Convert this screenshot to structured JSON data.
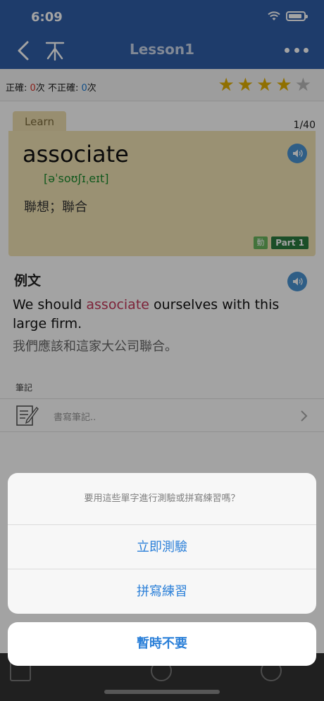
{
  "status_bar": {
    "time": "6:09"
  },
  "nav": {
    "title": "Lesson1"
  },
  "stats": {
    "correct_label": "正確: ",
    "correct_count": "0",
    "correct_unit": "次",
    "incorrect_label": " 不正確: ",
    "incorrect_count": "0",
    "incorrect_unit": "次",
    "rating": 4,
    "rating_max": 5
  },
  "card": {
    "tab_label": "Learn",
    "counter": "1/40",
    "word": "associate",
    "phonetic": "[əˈsoʊʃɪˌeɪt]",
    "meaning": "聯想；聯合",
    "pos_badge": "動",
    "part_badge": "Part 1"
  },
  "example": {
    "title": "例文",
    "sentence_before": "We should ",
    "sentence_highlight": "associate",
    "sentence_after": " ourselves with this large firm.",
    "translation": "我們應該和這家大公司聯合。"
  },
  "notes": {
    "label": "筆記",
    "placeholder": "書寫筆記.."
  },
  "action_sheet": {
    "message": "要用這些單字進行測驗或拼寫練習嗎？",
    "options": [
      "立即測驗",
      "拼寫練習"
    ],
    "cancel": "暫時不要"
  },
  "colors": {
    "header": "#2f5ea8",
    "card": "#f1e3b5",
    "accent": "#2a7fd8",
    "highlight": "#c4375a",
    "phonetic": "#1b8a2e"
  }
}
